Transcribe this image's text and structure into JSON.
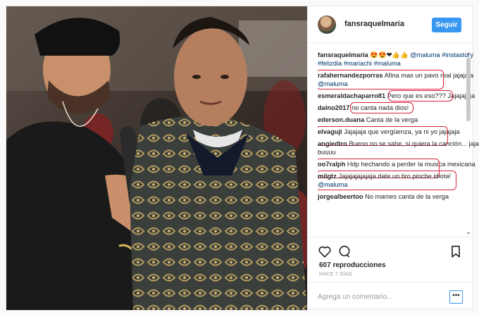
{
  "post": {
    "username": "fansraquelmaria",
    "follow_label": "Seguir",
    "caption": {
      "user": "fansraquelmaria",
      "emojis": "😍😍❤👍👍",
      "mention": "@maluma",
      "tags": "#instastory #felizdia #mariachi #maluma"
    },
    "comments": [
      {
        "user": "rafahernandezporras",
        "text": "Afina mas un pavo real jajajaja",
        "mention": "@maluma"
      },
      {
        "user": "esmeraldachaparro81",
        "text": "Pero que es eso??? Jajajajaja",
        "mention": ""
      },
      {
        "user": "dalno2017",
        "text": "no canta nada dios!",
        "mention": ""
      },
      {
        "user": "ederson.duana",
        "text": "Canta de la verga",
        "mention": ""
      },
      {
        "user": "elvaguji",
        "text": "Jajajaja que vergüenza, ya ni yo jajajaja",
        "mention": ""
      },
      {
        "user": "angiediro",
        "text": "Bueno no se sabe, si quiera la canción... jaja buuuu",
        "mention": ""
      },
      {
        "user": "oo7ralph",
        "text": "Hdp hechando a perder la musica mexicana",
        "mention": ""
      },
      {
        "user": "milgtz",
        "text": "Jajajajajajaja date un tiro pinche idiota!",
        "mention": "@maluma"
      },
      {
        "user": "jorgealbeertoo",
        "text": "No mames canta de la verga",
        "mention": ""
      }
    ],
    "views": "607 reproducciones",
    "time_ago": "HACE 7 DÍAS",
    "comment_placeholder": "Agrega un comentario...",
    "more_label": "•••",
    "icons": {
      "like": "heart-icon",
      "comment": "comment-icon",
      "save": "bookmark-icon",
      "more": "more-options-icon"
    },
    "colors": {
      "follow": "#3897f0",
      "highlight": "#d8223a",
      "mention": "#003569"
    }
  }
}
